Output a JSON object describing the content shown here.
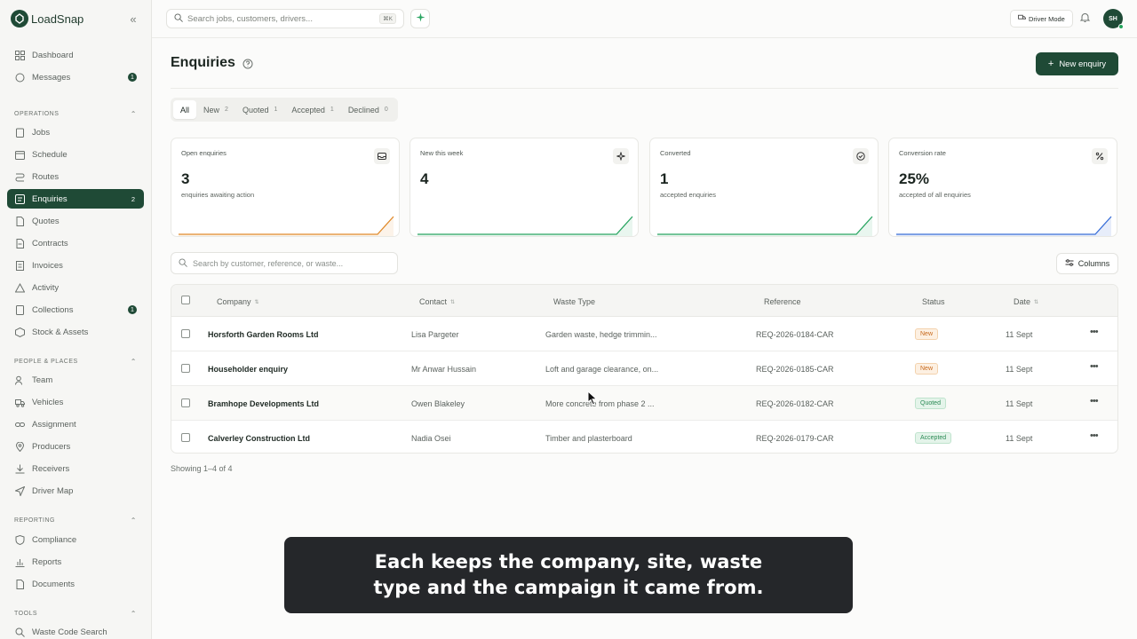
{
  "app": {
    "name": "LoadSnap"
  },
  "sidebar": {
    "top_items": [
      {
        "label": "Dashboard",
        "icon": "dashboard-icon"
      },
      {
        "label": "Messages",
        "icon": "message-icon",
        "badge": "1"
      }
    ],
    "sections": [
      {
        "title": "OPERATIONS",
        "items": [
          {
            "label": "Jobs"
          },
          {
            "label": "Schedule"
          },
          {
            "label": "Routes"
          },
          {
            "label": "Enquiries",
            "badge": "2",
            "active": true
          },
          {
            "label": "Quotes"
          },
          {
            "label": "Contracts"
          },
          {
            "label": "Invoices"
          },
          {
            "label": "Activity"
          },
          {
            "label": "Collections",
            "badge": "1"
          },
          {
            "label": "Stock & Assets"
          }
        ]
      },
      {
        "title": "PEOPLE & PLACES",
        "items": [
          {
            "label": "Team"
          },
          {
            "label": "Vehicles"
          },
          {
            "label": "Assignment"
          },
          {
            "label": "Producers"
          },
          {
            "label": "Receivers"
          },
          {
            "label": "Driver Map"
          }
        ]
      },
      {
        "title": "REPORTING",
        "items": [
          {
            "label": "Compliance"
          },
          {
            "label": "Reports"
          },
          {
            "label": "Documents"
          }
        ]
      },
      {
        "title": "TOOLS",
        "items": [
          {
            "label": "Waste Code Search"
          }
        ]
      }
    ]
  },
  "topbar": {
    "search_placeholder": "Search jobs, customers, drivers...",
    "shortcut": "⌘K",
    "driver_mode": "Driver Mode",
    "avatar_initials": "SH"
  },
  "page": {
    "title": "Enquiries",
    "new_button": "New enquiry",
    "tabs": [
      {
        "label": "All",
        "count": ""
      },
      {
        "label": "New",
        "count": "2"
      },
      {
        "label": "Quoted",
        "count": "1"
      },
      {
        "label": "Accepted",
        "count": "1"
      },
      {
        "label": "Declined",
        "count": "0"
      }
    ],
    "stats": [
      {
        "label": "Open enquiries",
        "value": "3",
        "sub": "enquiries awaiting action",
        "color": "#e08a2c"
      },
      {
        "label": "New this week",
        "value": "4",
        "sub": "",
        "color": "#2aa562"
      },
      {
        "label": "Converted",
        "value": "1",
        "sub": "accepted enquiries",
        "color": "#2aa562"
      },
      {
        "label": "Conversion rate",
        "value": "25%",
        "sub": "accepted of all enquiries",
        "color": "#3a6fd8"
      }
    ],
    "table_search_placeholder": "Search by customer, reference, or waste...",
    "columns_button": "Columns",
    "table": {
      "headers": {
        "company": "Company",
        "contact": "Contact",
        "waste": "Waste Type",
        "reference": "Reference",
        "status": "Status",
        "date": "Date"
      },
      "rows": [
        {
          "company": "Horsforth Garden Rooms Ltd",
          "contact": "Lisa Pargeter",
          "waste": "Garden waste, hedge trimmin...",
          "reference": "REQ-2026-0184-CAR",
          "status": "New",
          "date": "11 Sept"
        },
        {
          "company": "Householder enquiry",
          "contact": "Mr Anwar Hussain",
          "waste": "Loft and garage clearance, on...",
          "reference": "REQ-2026-0185-CAR",
          "status": "New",
          "date": "11 Sept"
        },
        {
          "company": "Bramhope Developments Ltd",
          "contact": "Owen Blakeley",
          "waste": "More concrete from phase 2 ...",
          "reference": "REQ-2026-0182-CAR",
          "status": "Quoted",
          "date": "11 Sept"
        },
        {
          "company": "Calverley Construction Ltd",
          "contact": "Nadia Osei",
          "waste": "Timber and plasterboard",
          "reference": "REQ-2026-0179-CAR",
          "status": "Accepted",
          "date": "11 Sept"
        }
      ]
    },
    "showing": "Showing 1–4 of 4"
  },
  "caption": "Each keeps the company, site, waste type and the campaign it came from.",
  "colors": {
    "brand": "#1f4a36",
    "new": "#c7691c",
    "quoted": "#2b8a55"
  }
}
